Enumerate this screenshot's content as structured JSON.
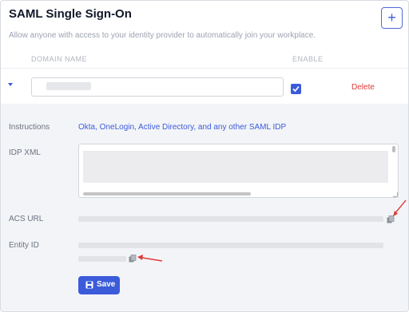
{
  "header": {
    "title": "SAML Single Sign-On",
    "subtitle": "Allow anyone with access to your identity provider to automatically join your workplace.",
    "add_label": "+"
  },
  "table": {
    "columns": [
      "DOMAIN NAME",
      "ENABLE"
    ],
    "row": {
      "domain_value": "",
      "enabled": true,
      "delete_label": "Delete"
    }
  },
  "details": {
    "instructions_label": "Instructions",
    "instructions_link": "Okta, OneLogin, Active Directory, and any other SAML IDP",
    "idp_xml_label": "IDP XML",
    "acs_url_label": "ACS URL",
    "entity_id_label": "Entity ID",
    "save_label": "Save"
  },
  "colors": {
    "accent": "#3b5bdb",
    "danger": "#dc3b3b",
    "annotation_arrow": "#e03b3b"
  },
  "icons": [
    "plus-icon",
    "caret-down-icon",
    "check-icon",
    "copy-icon",
    "floppy-disk-icon"
  ]
}
